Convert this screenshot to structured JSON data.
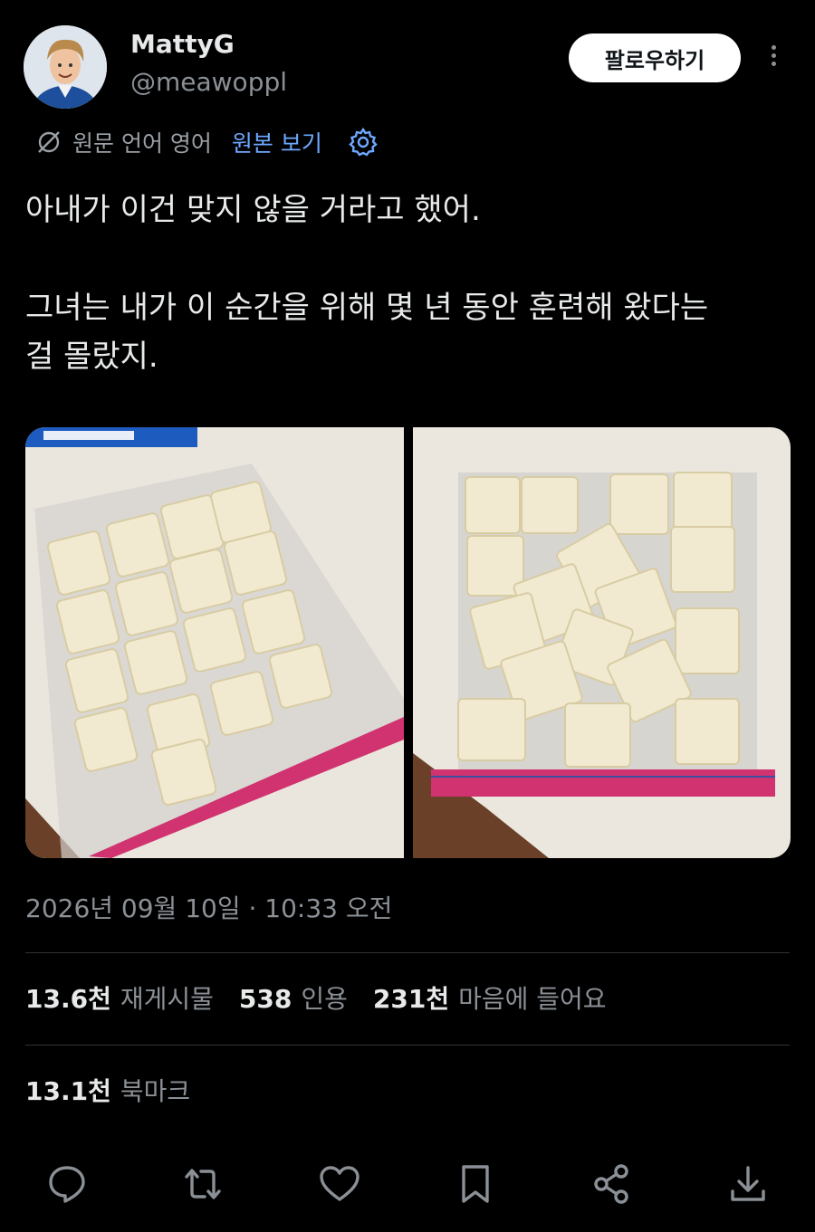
{
  "user": {
    "name": "MattyG",
    "handle": "@meawoppl"
  },
  "follow_button": "팔로우하기",
  "translate": {
    "original_lang": "원문 언어 영어",
    "view_original": "원본 보기"
  },
  "tweet": {
    "line1": "아내가 이건 맞지 않을 거라고 했어.",
    "line2": "그녀는 내가 이 순간을 위해 몇 년 동안 훈련해 왔다는",
    "line3": "걸 몰랐지."
  },
  "timestamp": "2026년 09월 10일 · 10:33 오전",
  "stats": {
    "reposts_count": "13.6천",
    "reposts_label": "재게시물",
    "quotes_count": "538",
    "quotes_label": "인용",
    "likes_count": "231천",
    "likes_label": "마음에 들어요",
    "bookmarks_count": "13.1천",
    "bookmarks_label": "북마크"
  },
  "icons": [
    "ellipsis-icon",
    "translate-icon",
    "gear-icon",
    "reply-icon",
    "repost-icon",
    "like-icon",
    "bookmark-icon",
    "share-icon",
    "download-icon"
  ]
}
